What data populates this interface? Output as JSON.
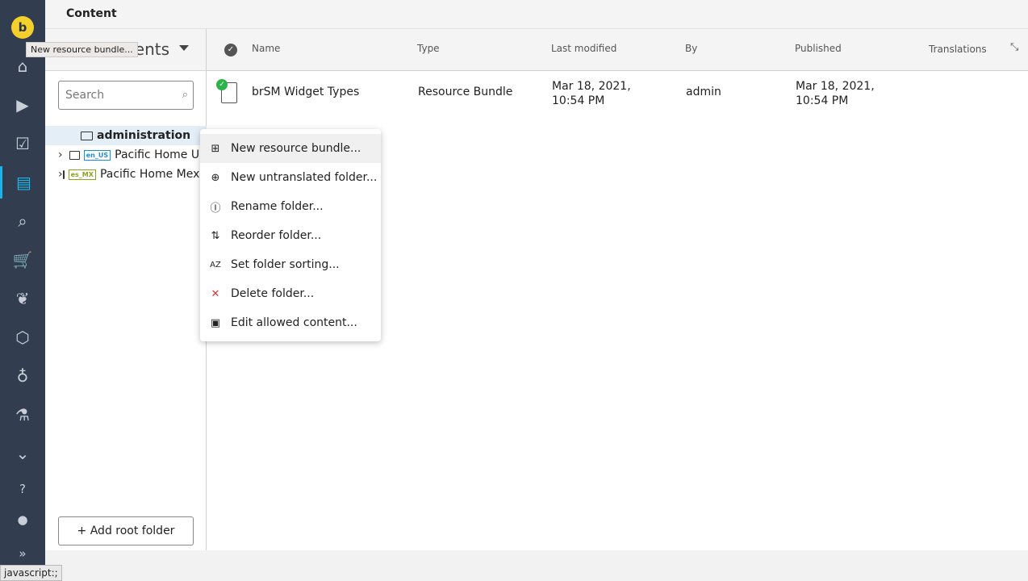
{
  "app": {
    "title": "Content",
    "logo": "b"
  },
  "sidebar": {
    "items": [
      {
        "icon": "home-icon",
        "glyph": "⌂"
      },
      {
        "icon": "play-icon",
        "glyph": "▶"
      },
      {
        "icon": "clipboard-check-icon",
        "glyph": "☑"
      },
      {
        "icon": "document-icon",
        "glyph": "▤",
        "active": true
      },
      {
        "icon": "document-search-icon",
        "glyph": "⌕"
      },
      {
        "icon": "cart-icon",
        "glyph": "🛒"
      },
      {
        "icon": "leaf-icon",
        "glyph": "❦"
      },
      {
        "icon": "cube-icon",
        "glyph": "⬡"
      },
      {
        "icon": "lightbulb-icon",
        "glyph": "♁"
      },
      {
        "icon": "flask-icon",
        "glyph": "⚗"
      },
      {
        "icon": "chevron-down-icon",
        "glyph": "⌄"
      },
      {
        "icon": "help-icon",
        "glyph": "?"
      },
      {
        "icon": "user-icon",
        "glyph": "●"
      },
      {
        "icon": "expand-icon",
        "glyph": "»"
      }
    ],
    "accent": "#1ab4e8"
  },
  "left_panel": {
    "title": "Documents",
    "search_placeholder": "Search",
    "tree": [
      {
        "label": "administration",
        "selected": true
      },
      {
        "label": "Pacific Home US",
        "badge": "en_US",
        "badge_color": "#1a8fd6"
      },
      {
        "label": "Pacific Home Mexico",
        "badge": "es_MX",
        "badge_color": "#8aa61a"
      }
    ],
    "add_root": "+ Add root folder"
  },
  "table": {
    "columns": [
      "Name",
      "Type",
      "Last modified",
      "By",
      "Published",
      "Translations"
    ],
    "rows": [
      {
        "name": "brSM Widget Types",
        "type": "Resource Bundle",
        "last_modified": "Mar 18, 2021, 10:54 PM",
        "by": "admin",
        "published": "Mar 18, 2021, 10:54 PM",
        "translations": ""
      }
    ]
  },
  "context_menu": [
    {
      "label": "New resource bundle...",
      "icon": "new-bundle-icon",
      "glyph": "⊞"
    },
    {
      "label": "New untranslated folder...",
      "icon": "new-folder-icon",
      "glyph": "⊕"
    },
    {
      "label": "Rename folder...",
      "icon": "rename-icon",
      "glyph": "Ⓘ"
    },
    {
      "label": "Reorder folder...",
      "icon": "reorder-icon",
      "glyph": "⇅"
    },
    {
      "label": "Set folder sorting...",
      "icon": "sort-az-icon",
      "glyph": "AZ"
    },
    {
      "label": "Delete folder...",
      "icon": "delete-icon",
      "glyph": "✕",
      "color": "#d9333f"
    },
    {
      "label": "Edit allowed content...",
      "icon": "edit-allowed-icon",
      "glyph": "▣"
    }
  ],
  "tooltip": "New resource bundle...",
  "status_bar": "javascript:;"
}
